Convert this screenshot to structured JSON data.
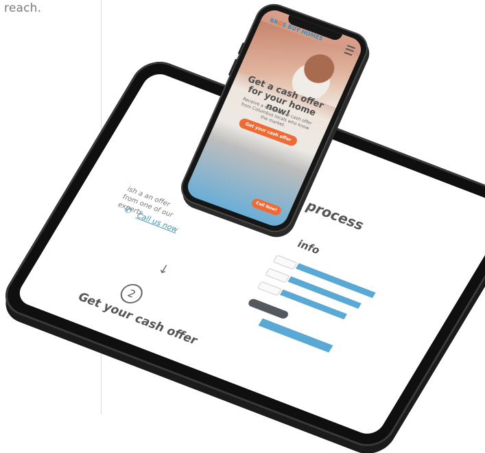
{
  "page": {
    "lead_text": "reach."
  },
  "tablet": {
    "heading": "process",
    "info_label": "info",
    "offer_text": "from one of our experts.",
    "offer_text_top": "ish a an offer",
    "call_link": "Call us now",
    "step_number": "2",
    "step_label": "Get your cash offer"
  },
  "phone": {
    "logo_left": "BR",
    "logo_o": "O",
    "logo_right": "S",
    "logo_tail": "BUY HOMES",
    "headline": "Get a cash offer for your home now!",
    "subtext": "Receive a competitive cash offer from Columbus locals who know the market.",
    "cta_label": "Get your cash offer",
    "call_label": "Call Now!"
  },
  "colors": {
    "brand_blue": "#2f93c7",
    "brand_orange": "#ef6a35",
    "form_blue": "#5aa9d4",
    "device_black": "#151515"
  }
}
